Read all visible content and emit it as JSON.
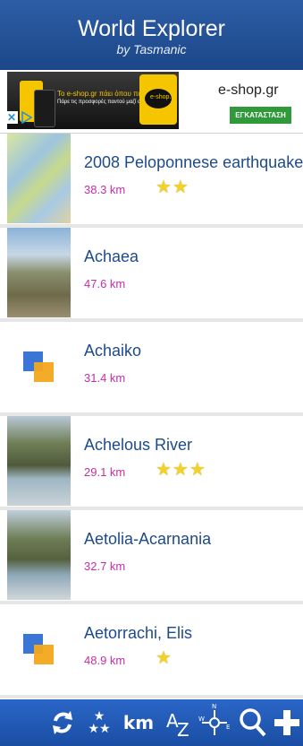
{
  "header": {
    "title": "World Explorer",
    "subtitle": "by Tasmanic"
  },
  "ad": {
    "headline": "Το e-shop.gr πάει όπου πας!",
    "subline": "Πάρε τις προσφορές παντού μαζί σου!",
    "logo_text": "e-shop.gr",
    "site": "e-shop.gr",
    "install_label": "ΕΓΚΑΤΑΣΤΑΣΗ"
  },
  "items": [
    {
      "name": "2008 Peloponnese earthquake",
      "distance": "38.3 km",
      "stars": "★★",
      "thumb": "map-thumbnail"
    },
    {
      "name": "Achaea",
      "distance": "47.6 km",
      "stars": "",
      "thumb": "landscape-thumbnail"
    },
    {
      "name": "Achaiko",
      "distance": "31.4 km",
      "stars": "",
      "thumb": "placeholder-icon"
    },
    {
      "name": "Achelous River",
      "distance": "29.1 km",
      "stars": "★★★",
      "thumb": "river-thumbnail"
    },
    {
      "name": "Aetolia-Acarnania",
      "distance": "32.7 km",
      "stars": "",
      "thumb": "river-thumbnail"
    },
    {
      "name": "Aetorrachi, Elis",
      "distance": "48.9 km",
      "stars": "★",
      "thumb": "placeholder-icon"
    }
  ],
  "toolbar": {
    "km_label": "km",
    "sort_label": "A",
    "sort_sub": "Z",
    "icons": [
      "refresh-icon",
      "stars-filter-icon",
      "km-units-icon",
      "sort-az-icon",
      "compass-icon",
      "search-icon",
      "add-icon"
    ]
  },
  "colors": {
    "header": "#2d5ea6",
    "title_text": "#1d4a8c",
    "distance_text": "#c42fa6",
    "star": "#f0d22a",
    "toolbar": "#2b66c7"
  }
}
